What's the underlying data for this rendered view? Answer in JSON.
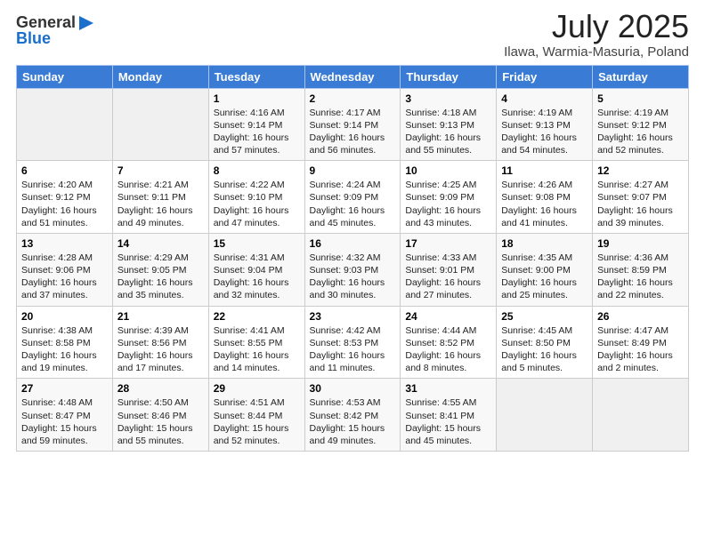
{
  "header": {
    "logo_general": "General",
    "logo_blue": "Blue",
    "month_title": "July 2025",
    "location": "Ilawa, Warmia-Masuria, Poland"
  },
  "weekdays": [
    "Sunday",
    "Monday",
    "Tuesday",
    "Wednesday",
    "Thursday",
    "Friday",
    "Saturday"
  ],
  "rows": [
    [
      {
        "day": "",
        "sunrise": "",
        "sunset": "",
        "daylight": ""
      },
      {
        "day": "",
        "sunrise": "",
        "sunset": "",
        "daylight": ""
      },
      {
        "day": "1",
        "sunrise": "Sunrise: 4:16 AM",
        "sunset": "Sunset: 9:14 PM",
        "daylight": "Daylight: 16 hours and 57 minutes."
      },
      {
        "day": "2",
        "sunrise": "Sunrise: 4:17 AM",
        "sunset": "Sunset: 9:14 PM",
        "daylight": "Daylight: 16 hours and 56 minutes."
      },
      {
        "day": "3",
        "sunrise": "Sunrise: 4:18 AM",
        "sunset": "Sunset: 9:13 PM",
        "daylight": "Daylight: 16 hours and 55 minutes."
      },
      {
        "day": "4",
        "sunrise": "Sunrise: 4:19 AM",
        "sunset": "Sunset: 9:13 PM",
        "daylight": "Daylight: 16 hours and 54 minutes."
      },
      {
        "day": "5",
        "sunrise": "Sunrise: 4:19 AM",
        "sunset": "Sunset: 9:12 PM",
        "daylight": "Daylight: 16 hours and 52 minutes."
      }
    ],
    [
      {
        "day": "6",
        "sunrise": "Sunrise: 4:20 AM",
        "sunset": "Sunset: 9:12 PM",
        "daylight": "Daylight: 16 hours and 51 minutes."
      },
      {
        "day": "7",
        "sunrise": "Sunrise: 4:21 AM",
        "sunset": "Sunset: 9:11 PM",
        "daylight": "Daylight: 16 hours and 49 minutes."
      },
      {
        "day": "8",
        "sunrise": "Sunrise: 4:22 AM",
        "sunset": "Sunset: 9:10 PM",
        "daylight": "Daylight: 16 hours and 47 minutes."
      },
      {
        "day": "9",
        "sunrise": "Sunrise: 4:24 AM",
        "sunset": "Sunset: 9:09 PM",
        "daylight": "Daylight: 16 hours and 45 minutes."
      },
      {
        "day": "10",
        "sunrise": "Sunrise: 4:25 AM",
        "sunset": "Sunset: 9:09 PM",
        "daylight": "Daylight: 16 hours and 43 minutes."
      },
      {
        "day": "11",
        "sunrise": "Sunrise: 4:26 AM",
        "sunset": "Sunset: 9:08 PM",
        "daylight": "Daylight: 16 hours and 41 minutes."
      },
      {
        "day": "12",
        "sunrise": "Sunrise: 4:27 AM",
        "sunset": "Sunset: 9:07 PM",
        "daylight": "Daylight: 16 hours and 39 minutes."
      }
    ],
    [
      {
        "day": "13",
        "sunrise": "Sunrise: 4:28 AM",
        "sunset": "Sunset: 9:06 PM",
        "daylight": "Daylight: 16 hours and 37 minutes."
      },
      {
        "day": "14",
        "sunrise": "Sunrise: 4:29 AM",
        "sunset": "Sunset: 9:05 PM",
        "daylight": "Daylight: 16 hours and 35 minutes."
      },
      {
        "day": "15",
        "sunrise": "Sunrise: 4:31 AM",
        "sunset": "Sunset: 9:04 PM",
        "daylight": "Daylight: 16 hours and 32 minutes."
      },
      {
        "day": "16",
        "sunrise": "Sunrise: 4:32 AM",
        "sunset": "Sunset: 9:03 PM",
        "daylight": "Daylight: 16 hours and 30 minutes."
      },
      {
        "day": "17",
        "sunrise": "Sunrise: 4:33 AM",
        "sunset": "Sunset: 9:01 PM",
        "daylight": "Daylight: 16 hours and 27 minutes."
      },
      {
        "day": "18",
        "sunrise": "Sunrise: 4:35 AM",
        "sunset": "Sunset: 9:00 PM",
        "daylight": "Daylight: 16 hours and 25 minutes."
      },
      {
        "day": "19",
        "sunrise": "Sunrise: 4:36 AM",
        "sunset": "Sunset: 8:59 PM",
        "daylight": "Daylight: 16 hours and 22 minutes."
      }
    ],
    [
      {
        "day": "20",
        "sunrise": "Sunrise: 4:38 AM",
        "sunset": "Sunset: 8:58 PM",
        "daylight": "Daylight: 16 hours and 19 minutes."
      },
      {
        "day": "21",
        "sunrise": "Sunrise: 4:39 AM",
        "sunset": "Sunset: 8:56 PM",
        "daylight": "Daylight: 16 hours and 17 minutes."
      },
      {
        "day": "22",
        "sunrise": "Sunrise: 4:41 AM",
        "sunset": "Sunset: 8:55 PM",
        "daylight": "Daylight: 16 hours and 14 minutes."
      },
      {
        "day": "23",
        "sunrise": "Sunrise: 4:42 AM",
        "sunset": "Sunset: 8:53 PM",
        "daylight": "Daylight: 16 hours and 11 minutes."
      },
      {
        "day": "24",
        "sunrise": "Sunrise: 4:44 AM",
        "sunset": "Sunset: 8:52 PM",
        "daylight": "Daylight: 16 hours and 8 minutes."
      },
      {
        "day": "25",
        "sunrise": "Sunrise: 4:45 AM",
        "sunset": "Sunset: 8:50 PM",
        "daylight": "Daylight: 16 hours and 5 minutes."
      },
      {
        "day": "26",
        "sunrise": "Sunrise: 4:47 AM",
        "sunset": "Sunset: 8:49 PM",
        "daylight": "Daylight: 16 hours and 2 minutes."
      }
    ],
    [
      {
        "day": "27",
        "sunrise": "Sunrise: 4:48 AM",
        "sunset": "Sunset: 8:47 PM",
        "daylight": "Daylight: 15 hours and 59 minutes."
      },
      {
        "day": "28",
        "sunrise": "Sunrise: 4:50 AM",
        "sunset": "Sunset: 8:46 PM",
        "daylight": "Daylight: 15 hours and 55 minutes."
      },
      {
        "day": "29",
        "sunrise": "Sunrise: 4:51 AM",
        "sunset": "Sunset: 8:44 PM",
        "daylight": "Daylight: 15 hours and 52 minutes."
      },
      {
        "day": "30",
        "sunrise": "Sunrise: 4:53 AM",
        "sunset": "Sunset: 8:42 PM",
        "daylight": "Daylight: 15 hours and 49 minutes."
      },
      {
        "day": "31",
        "sunrise": "Sunrise: 4:55 AM",
        "sunset": "Sunset: 8:41 PM",
        "daylight": "Daylight: 15 hours and 45 minutes."
      },
      {
        "day": "",
        "sunrise": "",
        "sunset": "",
        "daylight": ""
      },
      {
        "day": "",
        "sunrise": "",
        "sunset": "",
        "daylight": ""
      }
    ]
  ]
}
